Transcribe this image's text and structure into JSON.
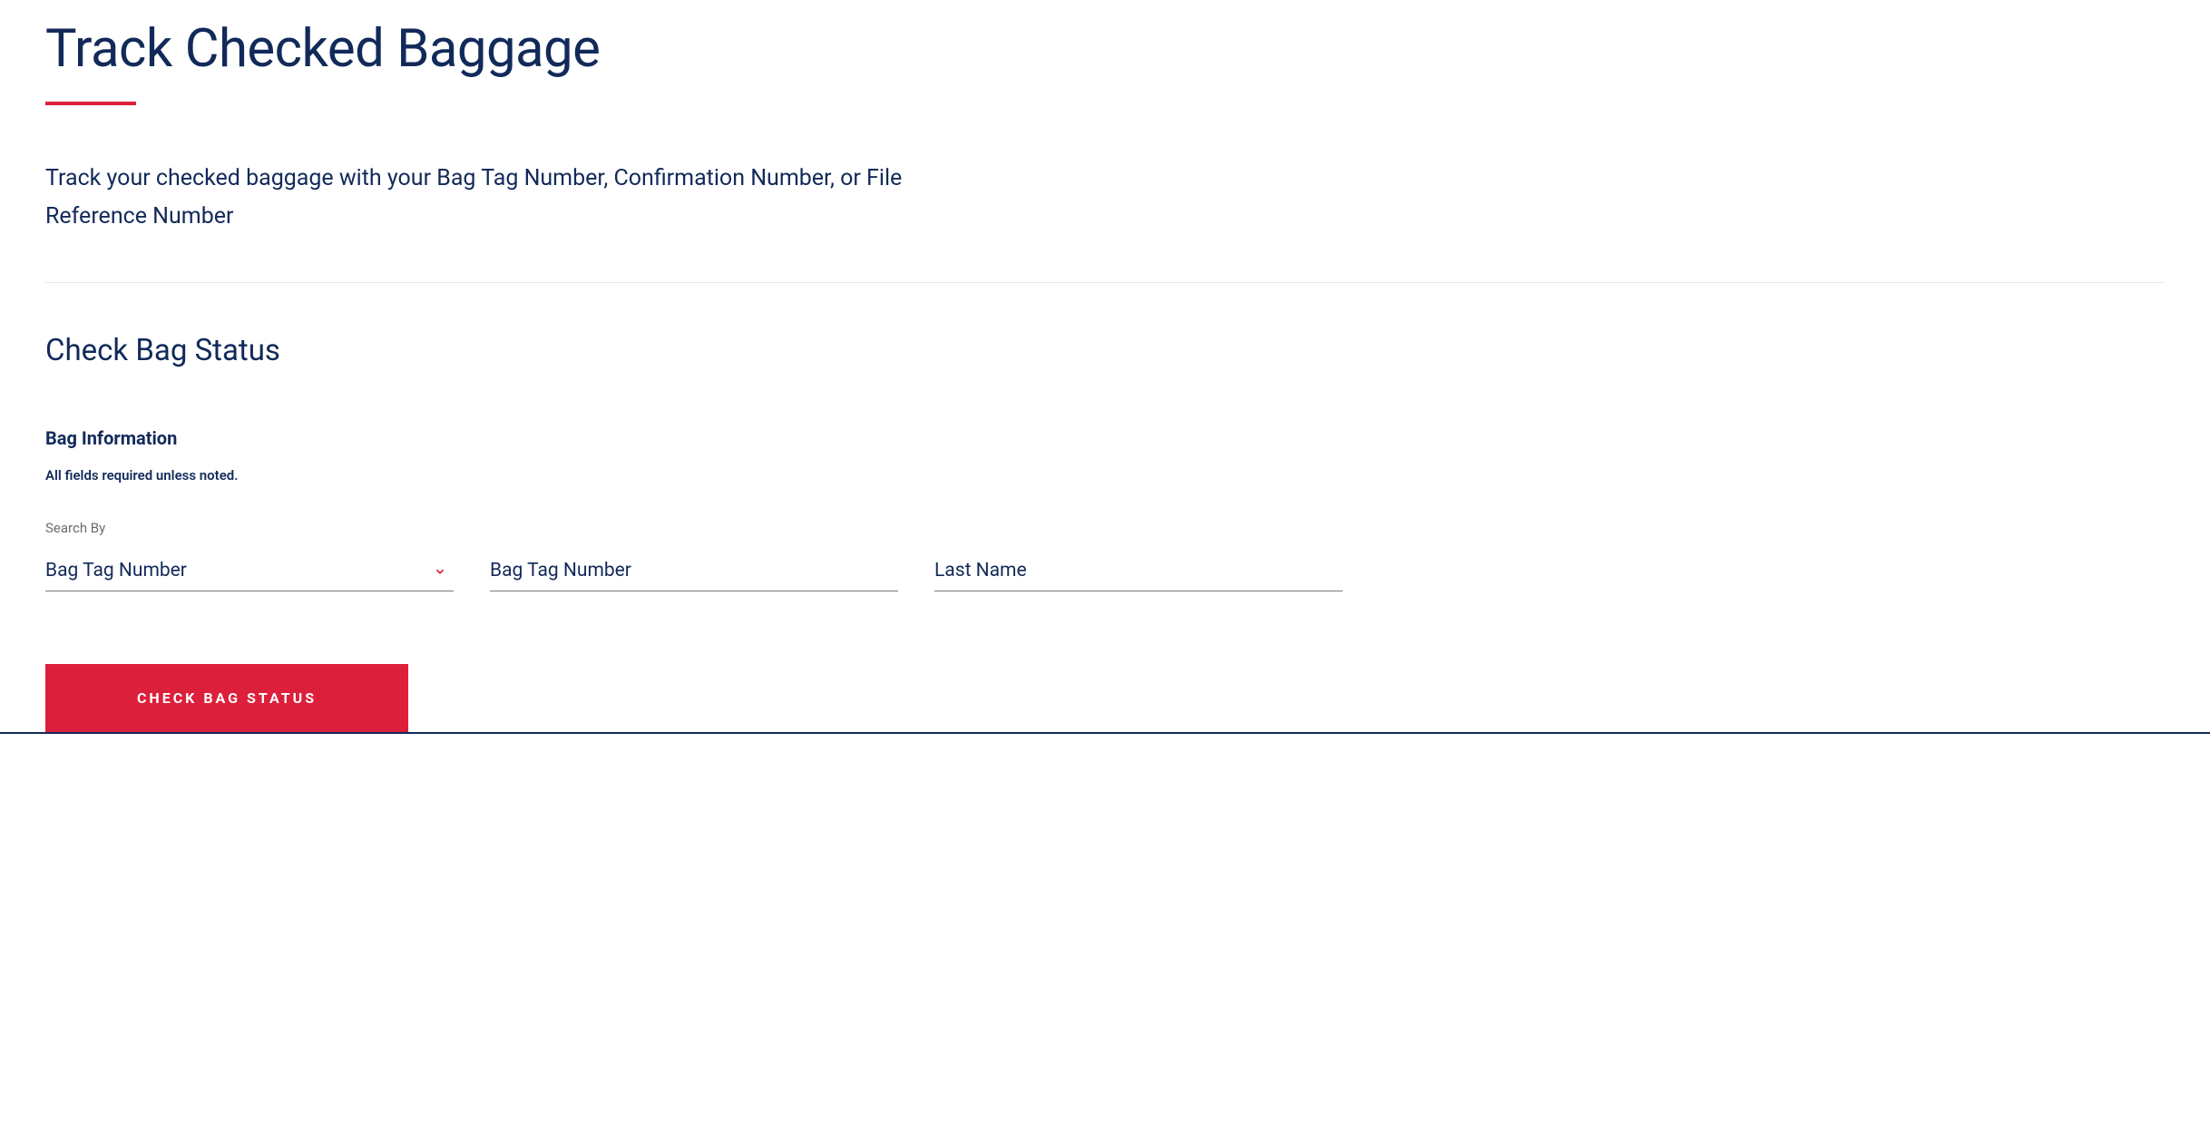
{
  "page": {
    "title": "Track Checked Baggage",
    "intro": "Track your checked baggage with your Bag Tag Number, Confirmation Number, or File Reference Number"
  },
  "section": {
    "title": "Check Bag Status",
    "subheading": "Bag Information",
    "required_note": "All fields required unless noted."
  },
  "form": {
    "search_by_label": "Search By",
    "search_by_value": "Bag Tag Number",
    "bag_tag_placeholder": "Bag Tag Number",
    "last_name_placeholder": "Last Name",
    "submit_label": "CHECK BAG STATUS"
  },
  "colors": {
    "primary_navy": "#122a5a",
    "accent_red": "#dc1f3a"
  }
}
